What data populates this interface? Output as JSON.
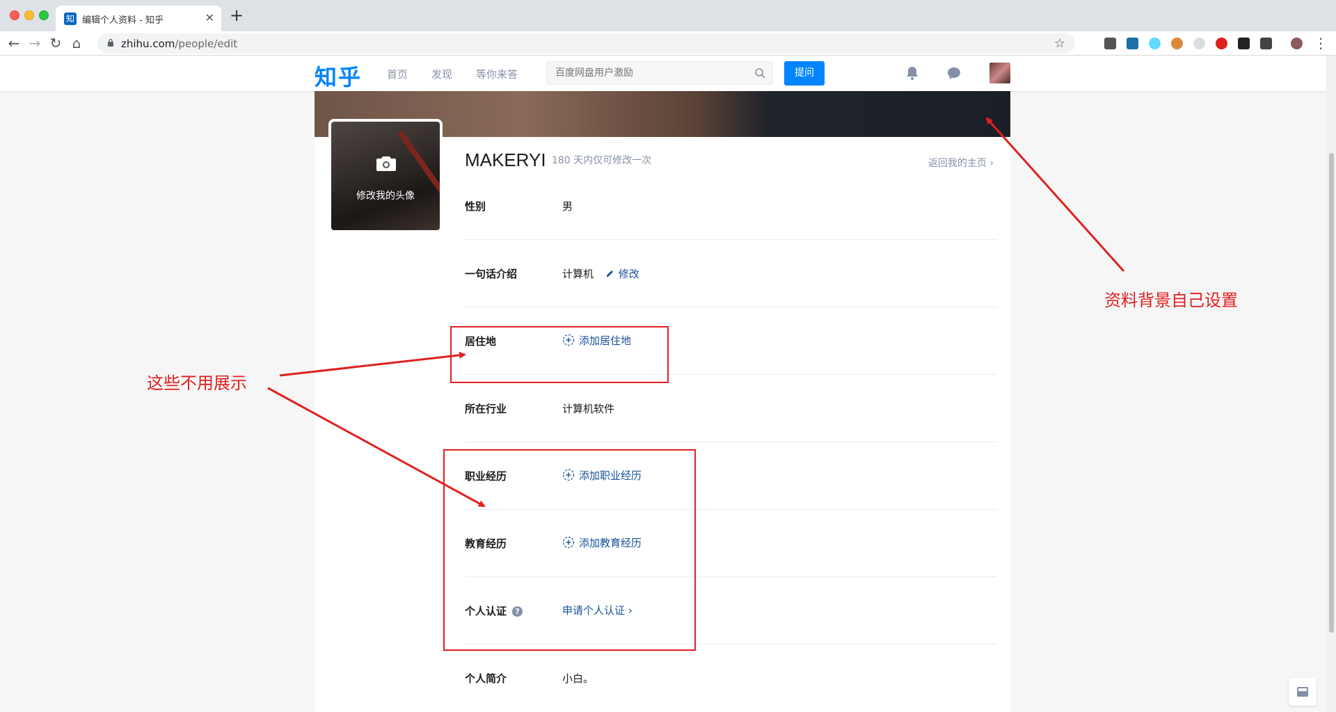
{
  "browser": {
    "tab_title": "编辑个人资料 - 知乎",
    "tab_favicon": "知",
    "new_tab": "+",
    "close": "✕",
    "url_host": "zhihu.com",
    "url_path": "/people/edit"
  },
  "header": {
    "logo": "知乎",
    "nav": [
      "首页",
      "发现",
      "等你来答"
    ],
    "search_placeholder": "百度网盘用户激励",
    "ask_button": "提问"
  },
  "profile": {
    "avatar_label": "修改我的头像",
    "name": "MAKERYI",
    "name_note": "180 天内仅可修改一次",
    "back_home": "返回我的主页 ›",
    "rows": [
      {
        "label": "性别",
        "value": "男"
      },
      {
        "label": "一句话介绍",
        "value": "计算机",
        "edit": "修改"
      },
      {
        "label": "居住地",
        "link": "添加居住地"
      },
      {
        "label": "所在行业",
        "value": "计算机软件"
      },
      {
        "label": "职业经历",
        "link": "添加职业经历"
      },
      {
        "label": "教育经历",
        "link": "添加教育经历"
      },
      {
        "label": "个人认证",
        "link": "申请个人认证 ›",
        "help": "?"
      },
      {
        "label": "个人简介",
        "value": "小白。"
      }
    ]
  },
  "annotations": {
    "cover_note": "资料背景自己设置",
    "hide_note": "这些不用展示",
    "color": "#e02020"
  },
  "colors": {
    "brand": "#0084ff",
    "link": "#175199",
    "muted": "#8590a6"
  }
}
